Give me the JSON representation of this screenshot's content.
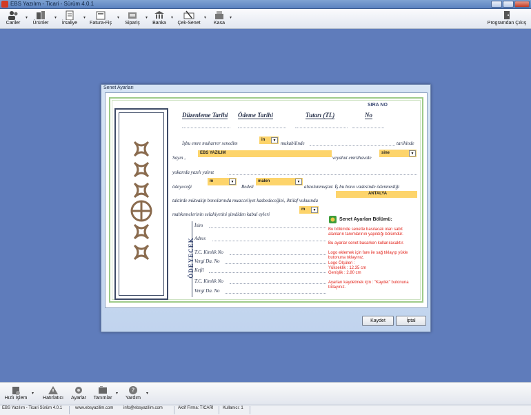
{
  "window": {
    "title": "EBS Yazılım - Ticari - Sürüm 4.0.1"
  },
  "toolbar": {
    "items": [
      {
        "label": "Cariler",
        "icon": "users-icon"
      },
      {
        "label": "Ürünler",
        "icon": "products-icon"
      },
      {
        "label": "İrsaliye",
        "icon": "dispatch-note-icon"
      },
      {
        "label": "Fatura-Fiş",
        "icon": "invoice-icon"
      },
      {
        "label": "Sipariş",
        "icon": "order-icon"
      },
      {
        "label": "Banka",
        "icon": "bank-icon"
      },
      {
        "label": "Çek-Senet",
        "icon": "check-note-icon"
      },
      {
        "label": "Kasa",
        "icon": "cash-register-icon"
      }
    ],
    "exit_label": "Programdan Çıkış"
  },
  "dialog": {
    "title": "Senet Ayarları",
    "sira_no": "SIRA NO",
    "headers": {
      "duzenleme": "Düzenleme Tarihi",
      "odeme": "Ödeme Tarihi",
      "tutari": "Tutarı (TL)",
      "no": "No"
    },
    "line1": {
      "prefix": "İşbu emre muharrer senedim",
      "in_value": "in",
      "mid": "mukabilinde",
      "suffix": "tarihinde"
    },
    "line2": {
      "prefix": "Sayın ,",
      "company": "EBS YAZILIM",
      "mid": "veyahut emrühavale",
      "sine_value": "sine"
    },
    "line3": {
      "text": "yukarıda yazılı yalnız"
    },
    "line4": {
      "prefix": "ödeyeceği",
      "m_value": "m",
      "mid": "Bedeli",
      "malen_value": "malen",
      "suffix": "ahzolunmuştur. İş bu bono vadesinde ödenmediği"
    },
    "line5": {
      "prefix": "taktirde müteakip bonolarında muacceliyet kasbedeceğini, ihtilaf vukuunda",
      "city": "ANTALYA"
    },
    "line6": {
      "prefix": "mahkemelerinin selahiyetini şimdiden kabul eyleri",
      "m_value": "m"
    },
    "odeyecek_label": "ÖDEYECEK",
    "fields": [
      "İsim",
      "Adres",
      "T.C. Kimlik No",
      "Vergi Da. No",
      "Kefil",
      "T.C. Kimlik No",
      "Vergi Da. No"
    ],
    "info": {
      "title": "Senet Ayarları Bölümü:",
      "p1": "Bu bölümde senette basılacak olan sabit alanların tanımlarının yapıldığı bölümdür.",
      "p2": "Bu ayarlar senet basarken kullanılacaktır.",
      "p3": "Logo eklemek için fare ile sağ tıklayıp yükle butonuna tıklayınız.",
      "p4a": "Logo Ölçüleri :",
      "p4b": "Yükseklik : 12.35 cm",
      "p4c": "Genişlik : 2.80 cm",
      "p5": "Ayarları kaydetmek için : \"Kaydet\" butonuna tıklayınız."
    },
    "buttons": {
      "save": "Kaydet",
      "cancel": "İptal"
    }
  },
  "bottombar": {
    "items": [
      {
        "label": "Hızlı İşlem",
        "icon": "quick-action-icon"
      },
      {
        "label": "Hatırlatıcı",
        "icon": "reminder-icon"
      },
      {
        "label": "Ayarlar",
        "icon": "settings-icon"
      },
      {
        "label": "Tanımlar",
        "icon": "definitions-icon"
      },
      {
        "label": "Yardım",
        "icon": "help-icon"
      }
    ]
  },
  "status": {
    "version": "EBS Yazılım - Ticari Sürüm 4.0.1",
    "website": "www.ebsyazilim.com",
    "email": "info@ebsyazilim.com",
    "firm": "Aktif Firma: TİCARİ",
    "user": "Kullanıcı: 1"
  }
}
